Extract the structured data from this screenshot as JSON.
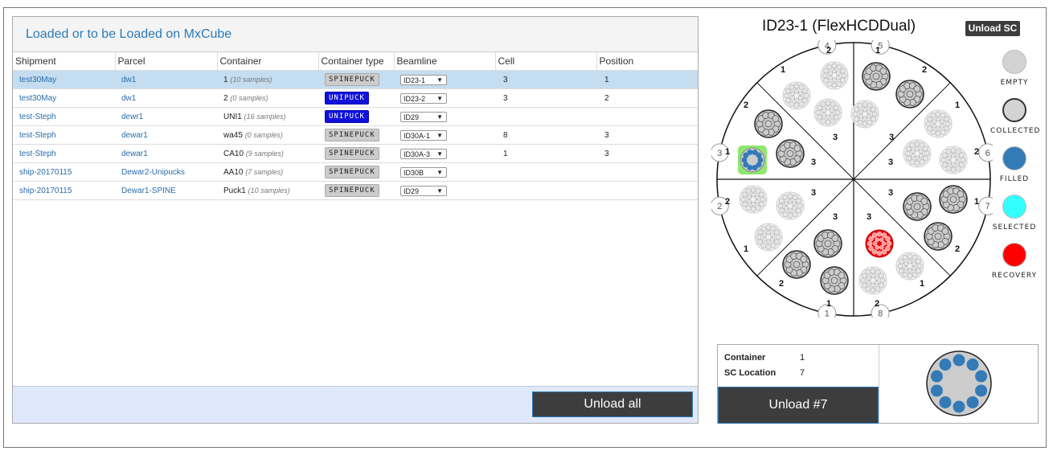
{
  "panel": {
    "title": "Loaded or to be Loaded on MxCube"
  },
  "columns": [
    "Shipment",
    "Parcel",
    "Container",
    "Container type",
    "Beamline",
    "Cell",
    "Position"
  ],
  "rows": [
    {
      "shipment": "test30May",
      "parcel": "dw1",
      "container": "1",
      "samples": "(10 samples)",
      "type": "SPINEPUCK",
      "beamline": "ID23-1",
      "cell": "3",
      "position": "1",
      "selected": true
    },
    {
      "shipment": "test30May",
      "parcel": "dw1",
      "container": "2",
      "samples": "(0 samples)",
      "type": "UNIPUCK",
      "beamline": "ID23-2",
      "cell": "3",
      "position": "2",
      "selected": false
    },
    {
      "shipment": "test-Steph",
      "parcel": "dewr1",
      "container": "UNI1",
      "samples": "(16 samples)",
      "type": "UNIPUCK",
      "beamline": "ID29",
      "cell": "",
      "position": "",
      "selected": false
    },
    {
      "shipment": "test-Steph",
      "parcel": "dewar1",
      "container": "wa45",
      "samples": "(0 samples)",
      "type": "SPINEPUCK",
      "beamline": "ID30A-1",
      "cell": "8",
      "position": "3",
      "selected": false
    },
    {
      "shipment": "test-Steph",
      "parcel": "dewar1",
      "container": "CA10",
      "samples": "(9 samples)",
      "type": "SPINEPUCK",
      "beamline": "ID30A-3",
      "cell": "1",
      "position": "3",
      "selected": false
    },
    {
      "shipment": "ship-20170115",
      "parcel": "Dewar2-Unipucks",
      "container": "AA10",
      "samples": "(7 samples)",
      "type": "SPINEPUCK",
      "beamline": "ID30B",
      "cell": "",
      "position": "",
      "selected": false
    },
    {
      "shipment": "ship-20170115",
      "parcel": "Dewar1-SPINE",
      "container": "Puck1",
      "samples": "(10 samples)",
      "type": "SPINEPUCK",
      "beamline": "ID29",
      "cell": "",
      "position": "",
      "selected": false
    }
  ],
  "footer": {
    "unload_all": "Unload all"
  },
  "sc": {
    "title": "ID23-1 (FlexHCDDual)",
    "unload_sc": "Unload SC",
    "cell_numbers": [
      "1",
      "2",
      "3",
      "4",
      "5",
      "6",
      "7",
      "8"
    ],
    "position_numbers": [
      "1",
      "2",
      "3"
    ]
  },
  "legend": [
    {
      "label": "EMPTY",
      "color": "#d3d3d3"
    },
    {
      "label": "COLLECTED",
      "color": "#d3d3d3"
    },
    {
      "label": "FILLED",
      "color": "#337ab7"
    },
    {
      "label": "SELECTED",
      "color": "#33ffff"
    },
    {
      "label": "RECOVERY",
      "color": "#ff0000"
    }
  ],
  "info": {
    "container_label": "Container",
    "container_value": "1",
    "location_label": "SC Location",
    "location_value": "7",
    "unload_button": "Unload #7"
  }
}
